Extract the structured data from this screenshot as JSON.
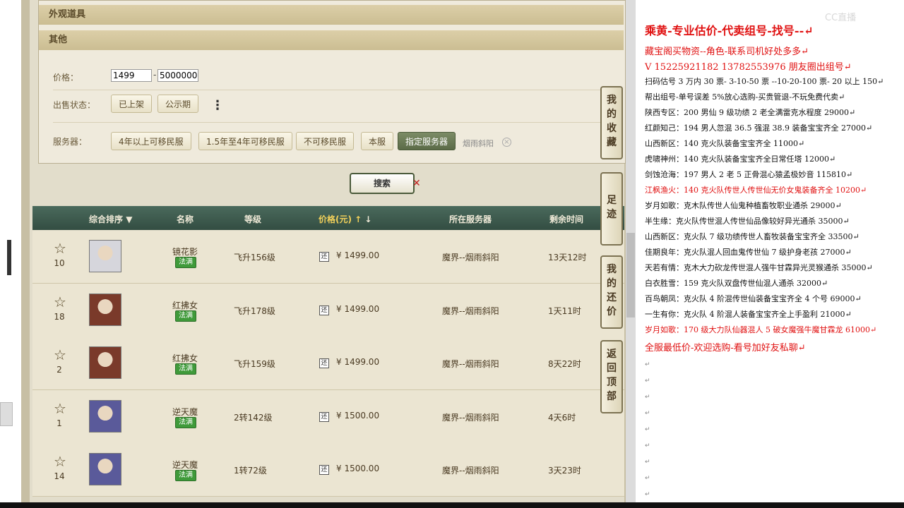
{
  "filters": {
    "section_appearance": "外观道具",
    "section_other": "其他",
    "price_label": "价格：",
    "price_min": "1499",
    "price_max": "5000000",
    "status_label": "出售状态：",
    "status_options": [
      "已上架",
      "公示期"
    ],
    "server_label": "服务器：",
    "server_options": [
      "4年以上可移民服",
      "1.5年至4年可移民服",
      "不可移民服",
      "本服",
      "指定服务器"
    ],
    "selected_server": "烟雨斜阳",
    "search_button": "搜索"
  },
  "table": {
    "columns": [
      "综合排序",
      "名称",
      "等级",
      "价格(元)",
      "所在服务器",
      "剩余时间"
    ],
    "rows": [
      {
        "fav": "10",
        "name": "镜花影",
        "badge": "法满",
        "level": "飞升156级",
        "price": "¥ 1499.00",
        "return": "还",
        "server": "魔界--烟雨斜阳",
        "time": "13天12时",
        "avatar_color": "#d6d6dc"
      },
      {
        "fav": "18",
        "name": "红拂女",
        "badge": "法满",
        "level": "飞升178级",
        "price": "¥ 1499.00",
        "return": "还",
        "server": "魔界--烟雨斜阳",
        "time": "1天11时",
        "avatar_color": "#7a3a2a"
      },
      {
        "fav": "2",
        "name": "红拂女",
        "badge": "法满",
        "level": "飞升159级",
        "price": "¥ 1499.00",
        "return": "还",
        "server": "魔界--烟雨斜阳",
        "time": "8天22时",
        "avatar_color": "#7a3a2a"
      },
      {
        "fav": "1",
        "name": "逆天魔",
        "badge": "法满",
        "level": "2转142级",
        "price": "¥ 1500.00",
        "return": "还",
        "server": "魔界--烟雨斜阳",
        "time": "4天6时",
        "avatar_color": "#5a5a9a"
      },
      {
        "fav": "14",
        "name": "逆天魔",
        "badge": "法满",
        "level": "1转72级",
        "price": "¥ 1500.00",
        "return": "还",
        "server": "魔界--烟雨斜阳",
        "time": "3天23时",
        "avatar_color": "#5a5a9a"
      }
    ]
  },
  "side_tabs": [
    {
      "chars": [
        "我",
        "的",
        "收",
        "藏"
      ]
    },
    {
      "chars": [
        "足",
        "迹"
      ]
    },
    {
      "chars": [
        "我",
        "的",
        "还",
        "价"
      ]
    },
    {
      "chars": [
        "返",
        "回",
        "顶",
        "部"
      ]
    }
  ],
  "notes": {
    "watermark": "CC直播",
    "paragraph_mark": "↵",
    "lines": [
      {
        "text": "乘黄-专业估价-代卖组号-找号--↵",
        "style": "red big"
      },
      {
        "text": "藏宝阁买物资--角色-联系司机好处多多↵",
        "style": "red med"
      },
      {
        "text": "V 15225921182        13782553976 朋友圈出组号↵",
        "style": "red med"
      },
      {
        "text": "扫码估号 3 万内 30 票- 3-10-50 票  --10-20-100 票- 20 以上 150↵",
        "style": ""
      },
      {
        "text": "帮出组号-单号误差 5%放心选购-买贵管退-不玩免费代卖↵",
        "style": ""
      },
      {
        "text": "陕西专区：200 男仙 9 级功绩 2 老全满雷克水程度 29000↵",
        "style": ""
      },
      {
        "text": "红颜知己：194 男人忽混 36.5 强混 38.9 装备宝宝齐全 27000↵",
        "style": ""
      },
      {
        "text": "山西新区：140 克火队装备宝宝齐全 11000↵",
        "style": ""
      },
      {
        "text": "虎啸神州：140 克火队装备宝宝齐全日常任塔 12000↵",
        "style": ""
      },
      {
        "text": "剑蚀沧海：197 男人 2 老 5 正骨混心猿孟极妙音 115810↵",
        "style": ""
      },
      {
        "text": "江枫渔火：140 克火队传世人传世仙无价女鬼装备齐全 10200↵",
        "style": "red"
      },
      {
        "text": "岁月如歌：克木队传世人仙鬼种植畜牧职业通杀 29000↵",
        "style": ""
      },
      {
        "text": "半生缘：克火队传世混人传世仙品像较好异光通杀 35000↵",
        "style": ""
      },
      {
        "text": "山西新区：克火队 7 级功绩传世人畜牧装备宝宝齐全 33500↵",
        "style": ""
      },
      {
        "text": "佳期良年：克火队混人回血鬼传世仙 7 级护身老孩 27000↵",
        "style": ""
      },
      {
        "text": "天若有情：克木大力砍龙传世混人强牛甘霖异光灵猴通杀 35000↵",
        "style": ""
      },
      {
        "text": "白衣胜雪：159 克火队双盘传世仙混人通杀 32000↵",
        "style": ""
      },
      {
        "text": "百鸟朝凤：克火队 4 阶混传世仙装备宝宝齐全 4 个号 69000↵",
        "style": ""
      },
      {
        "text": "一生有你：克火队 4 阶混人装备宝宝齐全上手盈利 21000↵",
        "style": ""
      },
      {
        "text": "岁月如歌：170 级大力队仙器混人 5 破女魔强牛魔甘霖龙 61000↵",
        "style": "red"
      },
      {
        "text": "全服最低价-欢迎选购-看号加好友私聊↵",
        "style": "red med"
      }
    ]
  }
}
